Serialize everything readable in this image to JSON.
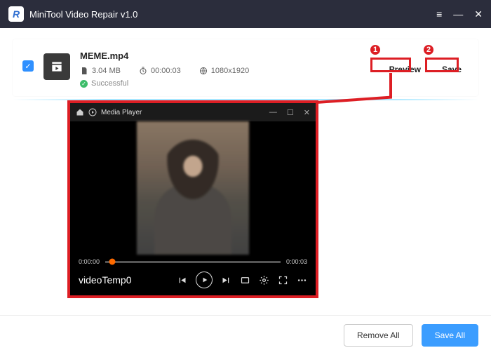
{
  "window": {
    "logo_letter": "R",
    "title": "MiniTool Video Repair v1.0"
  },
  "file": {
    "name": "MEME.mp4",
    "size": "3.04 MB",
    "duration": "00:00:03",
    "resolution": "1080x1920",
    "status_label": "Successful"
  },
  "actions": {
    "preview": "Preview",
    "save": "Save"
  },
  "player": {
    "title": "Media Player",
    "time_current": "0:00:00",
    "time_total": "0:00:03",
    "file_label": "videoTemp0"
  },
  "footer": {
    "remove_all": "Remove All",
    "save_all": "Save All"
  },
  "annotations": {
    "marker1": "1",
    "marker2": "2"
  }
}
